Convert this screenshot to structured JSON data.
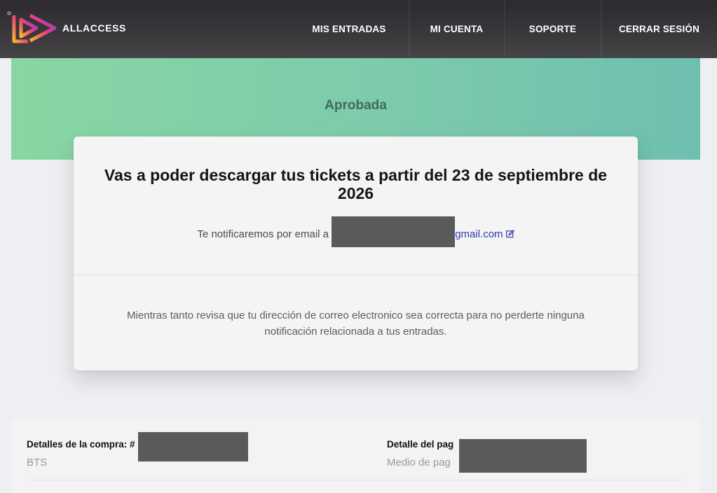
{
  "brand": {
    "name": "ALLACCESS",
    "colors": {
      "logo_gradient": [
        "#f7b52d",
        "#e8407a",
        "#7a3cf0"
      ]
    }
  },
  "nav": [
    {
      "label": "MIS ENTRADAS"
    },
    {
      "label": "MI CUENTA"
    },
    {
      "label": "SOPORTE"
    },
    {
      "label": "CERRAR SESIÓN"
    }
  ],
  "banner": {
    "status": "Aprobada",
    "colors": {
      "start": "#89d6a3",
      "end": "#6fbfb1"
    }
  },
  "card": {
    "title": "Vas a poder descargar tus tickets a partir del 23 de septiembre de 2026",
    "notify_prefix": "Te notificaremos por email a",
    "email_visible": "gmail.com",
    "note": "Mientras tanto revisa que tu dirección de correo electronico sea correcta para no perderte ninguna notificación relacionada a tus entradas."
  },
  "details": {
    "purchase_title": "Detalles de la compra: #",
    "purchase_value": "BTS",
    "payment_title": "Detalle del pag",
    "payment_value": "Medio de pag"
  }
}
